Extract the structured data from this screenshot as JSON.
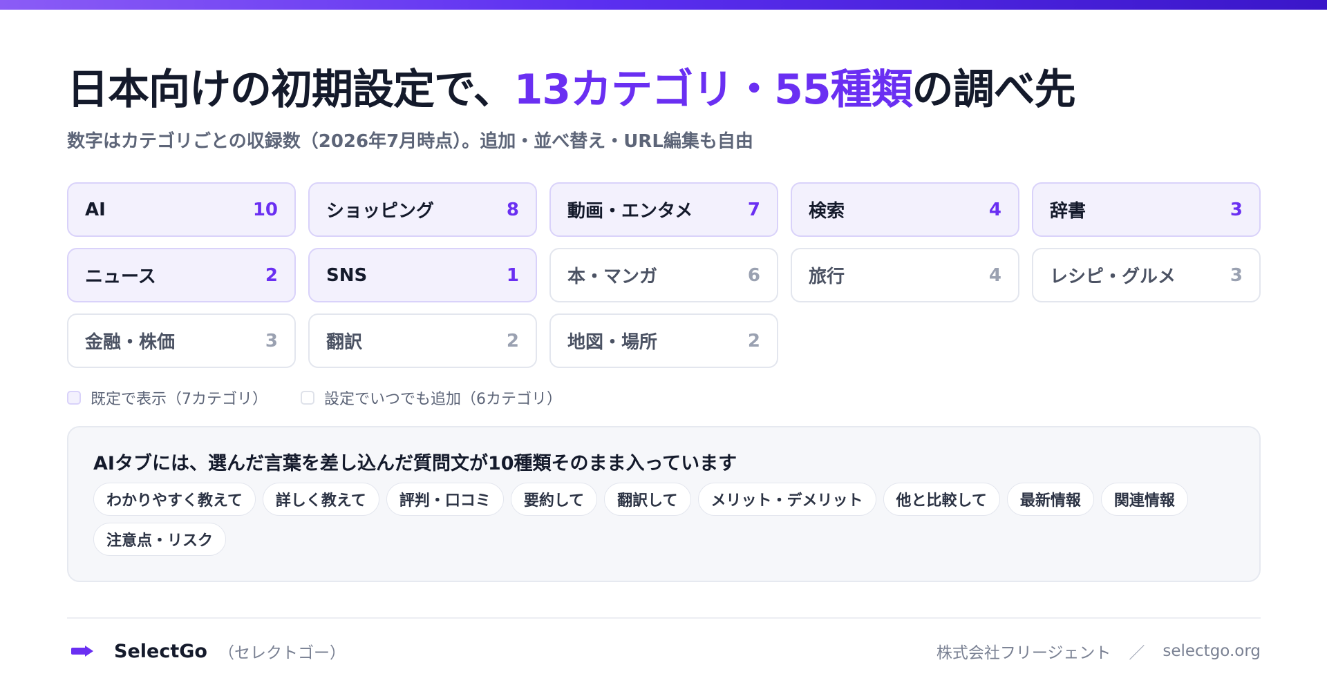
{
  "header": {
    "title_prefix": "日本向けの初期設定で、",
    "title_accent": "13カテゴリ・55種類",
    "title_suffix": "の調べ先",
    "subtitle": "数字はカテゴリごとの収録数（2026年7月時点）。追加・並べ替え・URL編集も自由"
  },
  "categories": [
    {
      "name": "AI",
      "count": "10",
      "default": true
    },
    {
      "name": "ショッピング",
      "count": "8",
      "default": true
    },
    {
      "name": "動画・エンタメ",
      "count": "7",
      "default": true
    },
    {
      "name": "検索",
      "count": "4",
      "default": true
    },
    {
      "name": "辞書",
      "count": "3",
      "default": true
    },
    {
      "name": "ニュース",
      "count": "2",
      "default": true
    },
    {
      "name": "SNS",
      "count": "1",
      "default": true
    },
    {
      "name": "本・マンガ",
      "count": "6",
      "default": false
    },
    {
      "name": "旅行",
      "count": "4",
      "default": false
    },
    {
      "name": "レシピ・グルメ",
      "count": "3",
      "default": false
    },
    {
      "name": "金融・株価",
      "count": "3",
      "default": false
    },
    {
      "name": "翻訳",
      "count": "2",
      "default": false
    },
    {
      "name": "地図・場所",
      "count": "2",
      "default": false
    }
  ],
  "legend": {
    "default_label": "既定で表示（7カテゴリ）",
    "optional_label": "設定でいつでも追加（6カテゴリ）"
  },
  "ai_panel": {
    "title": "AIタブには、選んだ言葉を差し込んだ質問文が10種類そのまま入っています",
    "prompts": [
      "わかりやすく教えて",
      "詳しく教えて",
      "評判・口コミ",
      "要約して",
      "翻訳して",
      "メリット・デメリット",
      "他と比較して",
      "最新情報",
      "関連情報",
      "注意点・リスク"
    ]
  },
  "footer": {
    "brand_name": "SelectGo",
    "brand_kana": "（セレクトゴー）",
    "company": "株式会社フリージェント",
    "separator": "／",
    "site": "selectgo.org"
  },
  "colors": {
    "accent": "#6a2ff2",
    "default_card_bg": "#f3f1fd",
    "default_card_border": "#d9d2fa",
    "text_dark": "#141a2b",
    "text_muted": "#5d6578"
  }
}
